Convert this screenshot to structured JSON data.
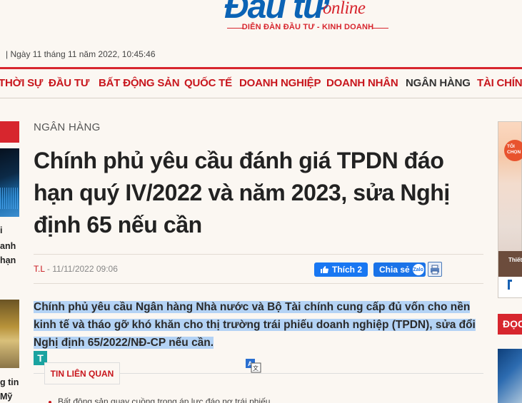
{
  "header": {
    "logo_main": "Đầu tư",
    "logo_online": "online",
    "tagline": "DIỄN ĐÀN ĐẦU TƯ - KINH DOANH",
    "date": "| Ngày 11 tháng 11 năm 2022, 10:45:46"
  },
  "nav": {
    "items": [
      "THỜI SỰ",
      "ĐẦU TƯ",
      "BẤT ĐỘNG SẢN",
      "QUỐC TẾ",
      "DOANH NGHIỆP",
      "DOANH NHÂN",
      "NGÂN HÀNG",
      "TÀI CHÍNH"
    ],
    "active_index": 6
  },
  "left_column": {
    "text_block_1": [
      "i",
      "anh",
      "hạn"
    ],
    "text_block_2": [
      "g tin",
      "Mỹ"
    ]
  },
  "article": {
    "category": "NGÂN HÀNG",
    "title": "Chính phủ yêu cầu đánh giá TPDN đáo hạn quý IV/2022 và năm 2023, sửa Nghị định 65 nếu cần",
    "author": "T.L",
    "date": "- 11/11/2022 09:06",
    "like_label": "Thích 2",
    "share_label": "Chia sẻ",
    "zalo_label": "Zalo",
    "sapo": "Chính phủ yêu cầu Ngân hàng Nhà nước và Bộ Tài chính cung cấp đủ vốn cho nền kinh tế và tháo gỡ khó khăn cho thị trường trái phiếu doanh nghiệp (TPDN), sửa đổi Nghị định 65/2022/NĐ-CP nếu cần.",
    "t_badge": "T",
    "related_title": "TIN LIÊN QUAN",
    "related_items": [
      "Bất động sản quay cuồng trong áp lực đáo nợ trái phiếu"
    ]
  },
  "right_column": {
    "ad_badge": "TÔI CHỌN",
    "ad_text": "Thiết",
    "doc_label": "ĐỌC"
  },
  "colors": {
    "brand_red": "#d7262e",
    "brand_blue": "#0b63b5",
    "highlight": "#b4d3f5"
  }
}
